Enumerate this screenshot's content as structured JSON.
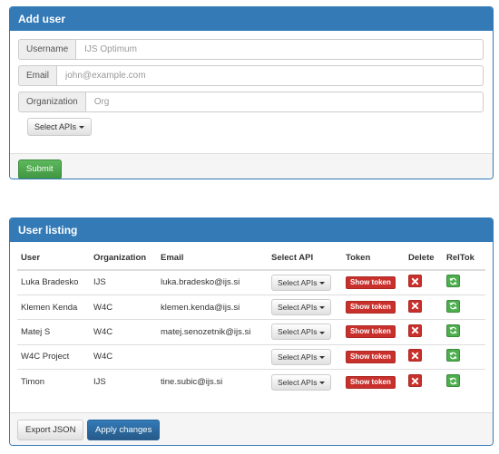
{
  "add_user": {
    "title": "Add user",
    "fields": {
      "username": {
        "label": "Username",
        "placeholder": "IJS Optimum"
      },
      "email": {
        "label": "Email",
        "placeholder": "john@example.com"
      },
      "organization": {
        "label": "Organization",
        "placeholder": "Org"
      }
    },
    "select_apis_label": "Select APIs",
    "submit_label": "Submit"
  },
  "user_listing": {
    "title": "User listing",
    "columns": [
      "User",
      "Organization",
      "Email",
      "Select API",
      "Token",
      "Delete",
      "RelTok"
    ],
    "rows": [
      {
        "user": "Luka Bradesko",
        "organization": "IJS",
        "email": "luka.bradesko@ijs.si"
      },
      {
        "user": "Klemen Kenda",
        "organization": "W4C",
        "email": "klemen.kenda@ijs.si"
      },
      {
        "user": "Matej S",
        "organization": "W4C",
        "email": "matej.senozetnik@ijs.si"
      },
      {
        "user": "W4C Project",
        "organization": "W4C",
        "email": ""
      },
      {
        "user": "Timon",
        "organization": "IJS",
        "email": "tine.subic@ijs.si"
      }
    ],
    "select_apis_label": "Select APIs",
    "show_token_label": "Show token",
    "export_label": "Export JSON",
    "apply_label": "Apply changes"
  },
  "colors": {
    "primary": "#337ab7",
    "success": "#5cb85c",
    "danger": "#c9302c"
  },
  "icons": {
    "dropdown": "caret-down-icon",
    "delete": "close-icon",
    "reload_token": "refresh-icon"
  }
}
